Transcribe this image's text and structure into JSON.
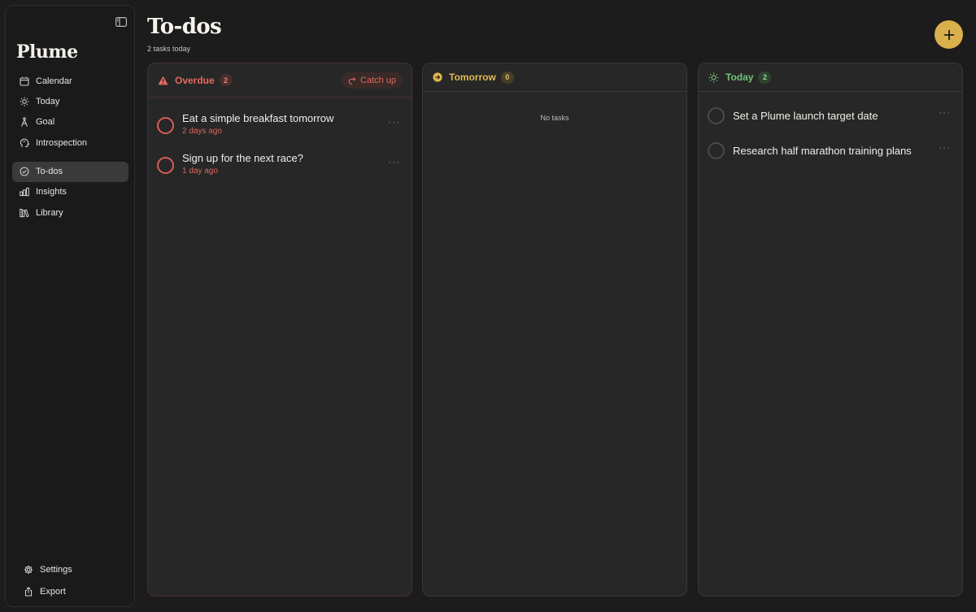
{
  "app": {
    "name": "Plume"
  },
  "sidebar": {
    "items": [
      {
        "label": "Calendar",
        "icon": "calendar-icon"
      },
      {
        "label": "Today",
        "icon": "sun-icon"
      },
      {
        "label": "Goal",
        "icon": "goal-icon"
      },
      {
        "label": "Introspection",
        "icon": "head-icon"
      },
      {
        "label": "To-dos",
        "icon": "check-circle-icon",
        "active": true
      },
      {
        "label": "Insights",
        "icon": "bar-chart-icon"
      },
      {
        "label": "Library",
        "icon": "library-icon"
      }
    ],
    "bottom": [
      {
        "label": "Settings",
        "icon": "gear-icon"
      },
      {
        "label": "Export",
        "icon": "export-icon"
      }
    ]
  },
  "header": {
    "title": "To-dos",
    "subtitle": "2 tasks today"
  },
  "columns": {
    "overdue": {
      "title": "Overdue",
      "count": "2",
      "action": "Catch up",
      "tasks": [
        {
          "title": "Eat a simple breakfast tomorrow",
          "meta": "2 days ago"
        },
        {
          "title": "Sign up for the next race?",
          "meta": "1 day ago"
        }
      ]
    },
    "tomorrow": {
      "title": "Tomorrow",
      "count": "0",
      "empty": "No tasks"
    },
    "today": {
      "title": "Today",
      "count": "2",
      "tasks": [
        {
          "title": "Set a Plume launch target date"
        },
        {
          "title": "Research half marathon training plans"
        }
      ]
    }
  },
  "colors": {
    "accent": "#d9b04c",
    "overdue": "#e26a5f",
    "tomorrow": "#e0b84f",
    "today": "#6fc27a",
    "background": "#1c1c1c"
  }
}
